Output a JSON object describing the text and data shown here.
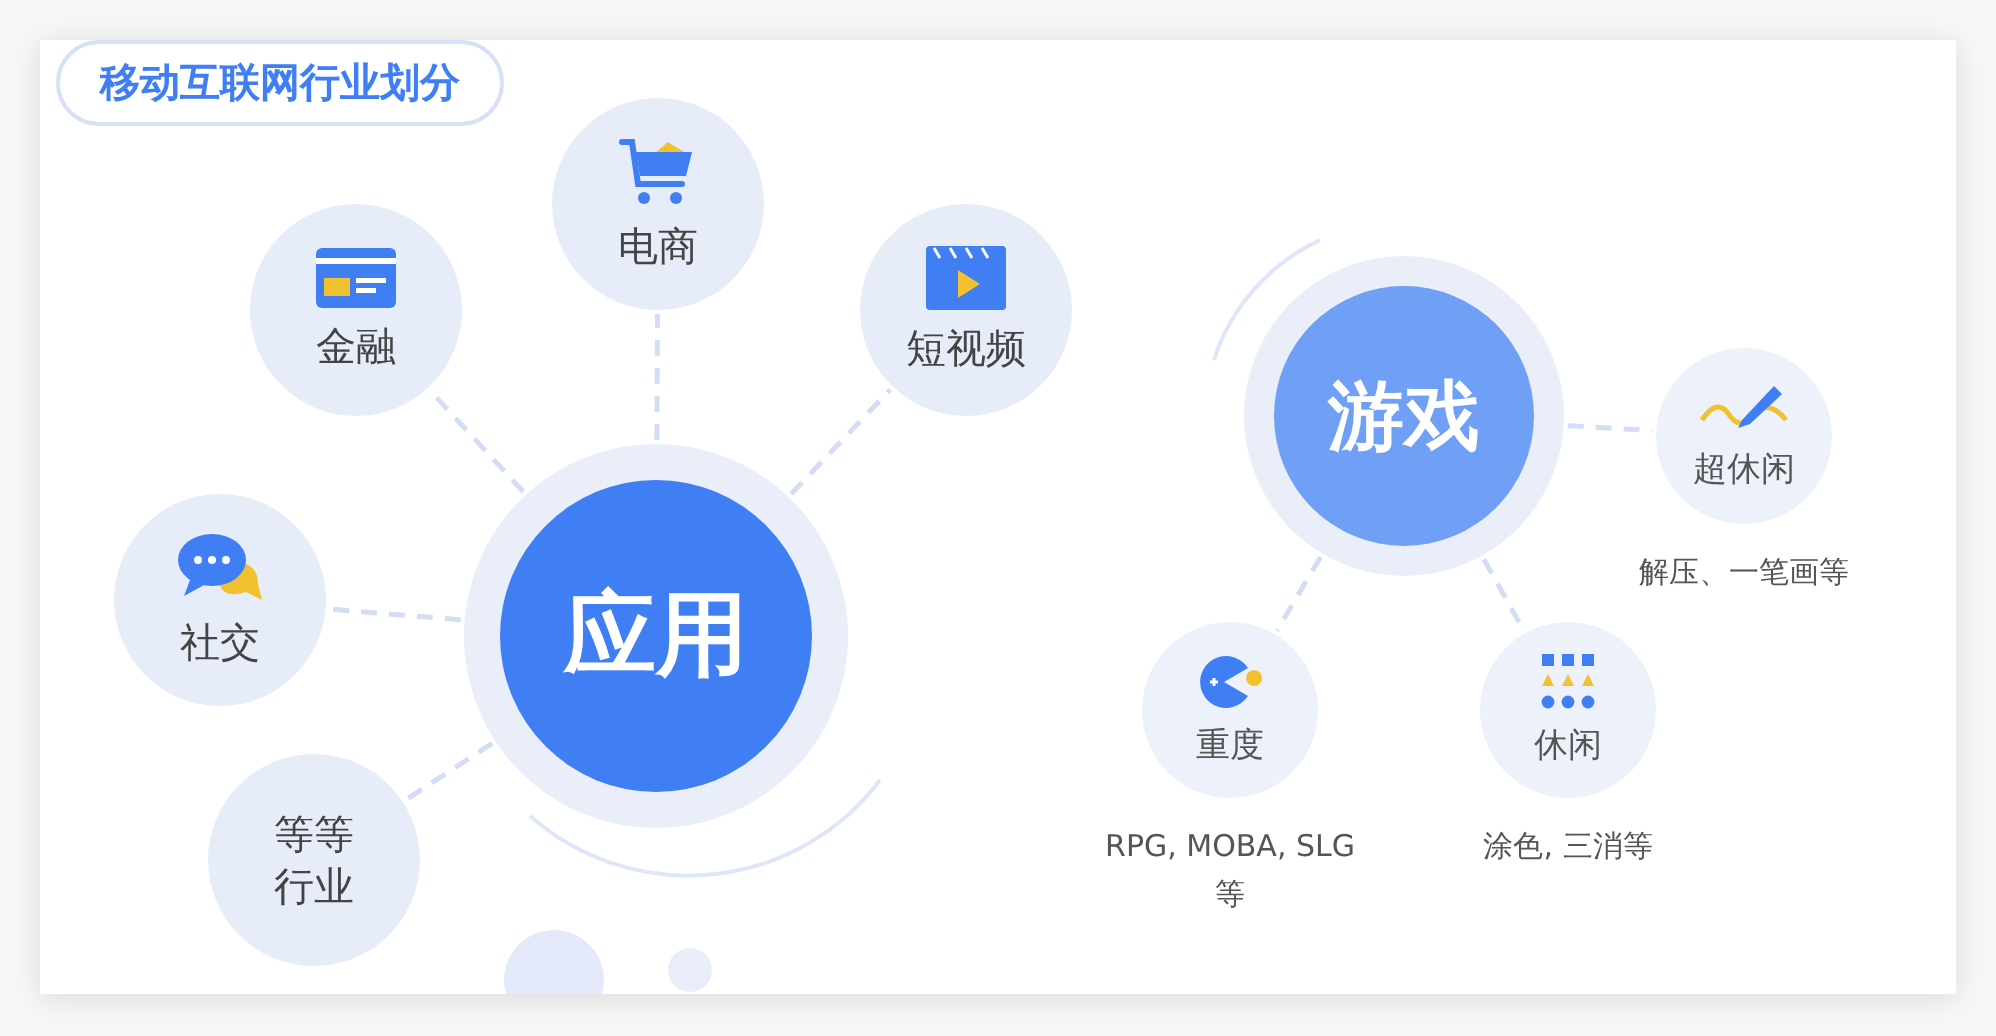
{
  "title": "移动互联网行业划分",
  "app_hub": {
    "label": "应用",
    "children": [
      {
        "label": "电商"
      },
      {
        "label": "金融"
      },
      {
        "label": "短视频"
      },
      {
        "label": "社交"
      },
      {
        "label": "等等行业"
      }
    ]
  },
  "game_hub": {
    "label": "游戏",
    "children": [
      {
        "label": "超休闲",
        "caption": "解压、一笔画等"
      },
      {
        "label": "重度",
        "caption": "RPG, MOBA, SLG 等"
      },
      {
        "label": "休闲",
        "caption": "涂色, 三消等"
      }
    ]
  }
}
